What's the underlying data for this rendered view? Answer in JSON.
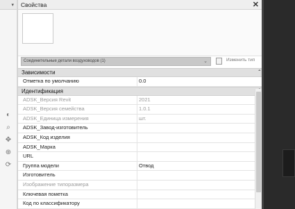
{
  "panel": {
    "title": "Свойства",
    "close_label": "✕",
    "type_selector": "Соединительные детали воздуховодов (1)",
    "edit_type_label": "Изменить тип"
  },
  "groups": [
    {
      "label": "Зависимости",
      "rows": [
        {
          "name": "Отметка по умолчанию",
          "value": "0.0",
          "readonly": false
        }
      ]
    },
    {
      "label": "Идентификация",
      "rows": [
        {
          "name": "ADSK_Версия Revit",
          "value": "2021",
          "readonly": true
        },
        {
          "name": "ADSK_Версия семейства",
          "value": "1.0.1",
          "readonly": true
        },
        {
          "name": "ADSK_Единица измерения",
          "value": "шт.",
          "readonly": true
        },
        {
          "name": "ADSK_Завод-изготовитель",
          "value": "",
          "readonly": false
        },
        {
          "name": "ADSK_Код изделия",
          "value": "",
          "readonly": false
        },
        {
          "name": "ADSK_Марка",
          "value": "",
          "readonly": false
        },
        {
          "name": "URL",
          "value": "",
          "readonly": false
        },
        {
          "name": "Группа модели",
          "value": "Отвод",
          "readonly": false
        },
        {
          "name": "Изготовитель",
          "value": "",
          "readonly": false
        },
        {
          "name": "Изображение типоразмера",
          "value": "",
          "readonly": true
        },
        {
          "name": "Ключевая пометка",
          "value": "",
          "readonly": false
        },
        {
          "name": "Код по классификатору",
          "value": "",
          "readonly": false
        }
      ]
    }
  ]
}
